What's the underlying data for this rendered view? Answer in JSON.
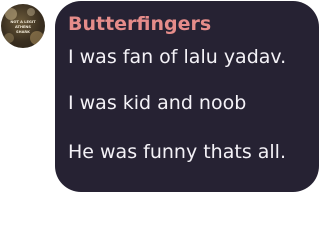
{
  "message": {
    "author": "Butterfingers",
    "author_color": "#e58c8a",
    "bubble_color": "#262233",
    "avatar": {
      "icon": "user-avatar-icon",
      "caption_lines": [
        "NOT A LEGIT",
        "ATHENS",
        "SHARK"
      ]
    },
    "lines": [
      "I was fan of lalu yadav.",
      "I was kid and noob",
      "He was funny thats all."
    ]
  }
}
